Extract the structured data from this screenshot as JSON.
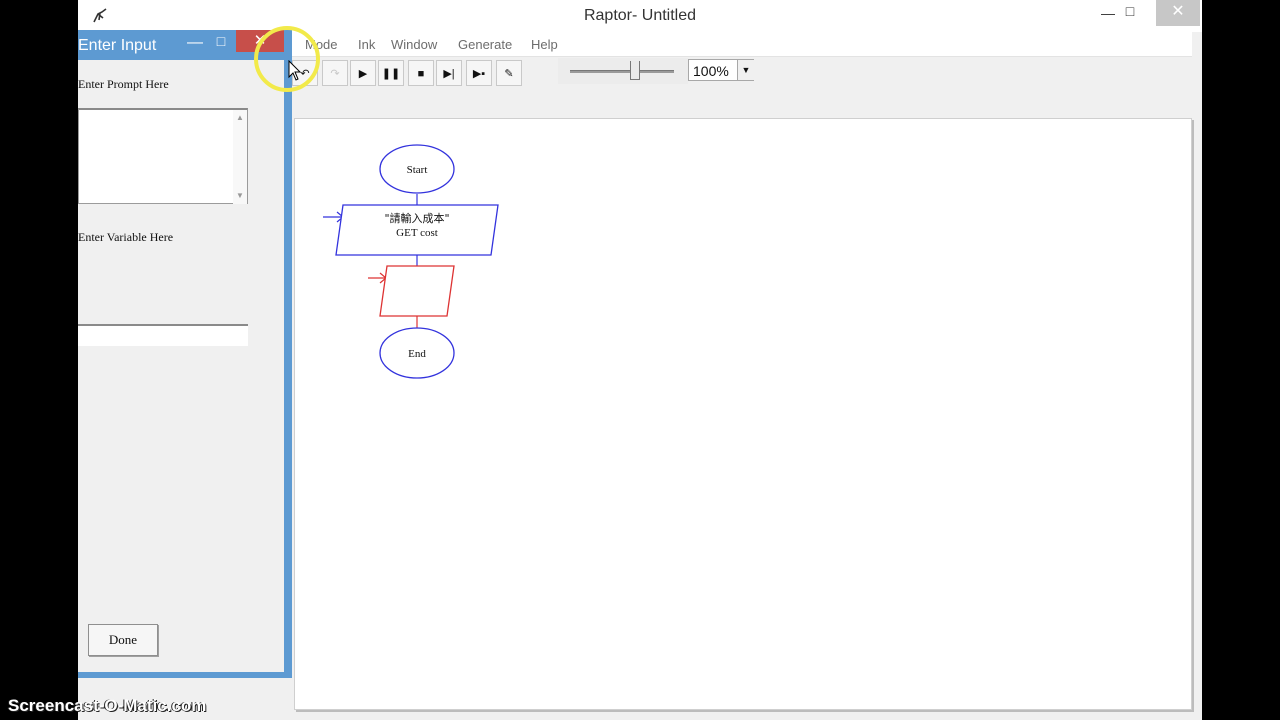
{
  "app": {
    "title": "Raptor- Untitled",
    "window_buttons": {
      "minimize": "—",
      "maximize": "□",
      "close": "✕"
    }
  },
  "menu": {
    "items": [
      "Mode",
      "Ink",
      "Window",
      "Generate",
      "Help"
    ]
  },
  "toolbar": {
    "buttons": [
      {
        "name": "undo-button",
        "icon": "undo-icon",
        "glyph": "↶",
        "enabled": true
      },
      {
        "name": "redo-button",
        "icon": "redo-icon",
        "glyph": "↷",
        "enabled": false
      },
      {
        "name": "run-button",
        "icon": "play-icon",
        "glyph": "▶",
        "enabled": true
      },
      {
        "name": "pause-button",
        "icon": "pause-icon",
        "glyph": "❚❚",
        "enabled": true
      },
      {
        "name": "stop-button",
        "icon": "stop-icon",
        "glyph": "■",
        "enabled": true
      },
      {
        "name": "step-button",
        "icon": "step-icon",
        "glyph": "▶|",
        "enabled": true
      },
      {
        "name": "step-into-button",
        "icon": "step-into-icon",
        "glyph": "▶▪",
        "enabled": true
      },
      {
        "name": "pen-button",
        "icon": "pen-icon",
        "glyph": "✎",
        "enabled": true
      }
    ],
    "zoom": {
      "value": "100%",
      "arrow": "▼"
    },
    "speed_level": 0.6
  },
  "flowchart": {
    "start_label": "Start",
    "input_prompt": "\"請輸入成本\"",
    "input_statement": "GET cost",
    "end_label": "End",
    "colors": {
      "symbol": "#3333dd",
      "selected": "#dd3333"
    }
  },
  "dialog": {
    "title": "Enter Input",
    "prompt_label": "Enter Prompt Here",
    "variable_label": "Enter Variable Here",
    "prompt_value": "",
    "variable_value": "",
    "done_label": "Done",
    "colors": {
      "frame": "#5d9ad2",
      "close": "#c74f4a"
    }
  },
  "watermark": "Screencast-O-Matic.com"
}
